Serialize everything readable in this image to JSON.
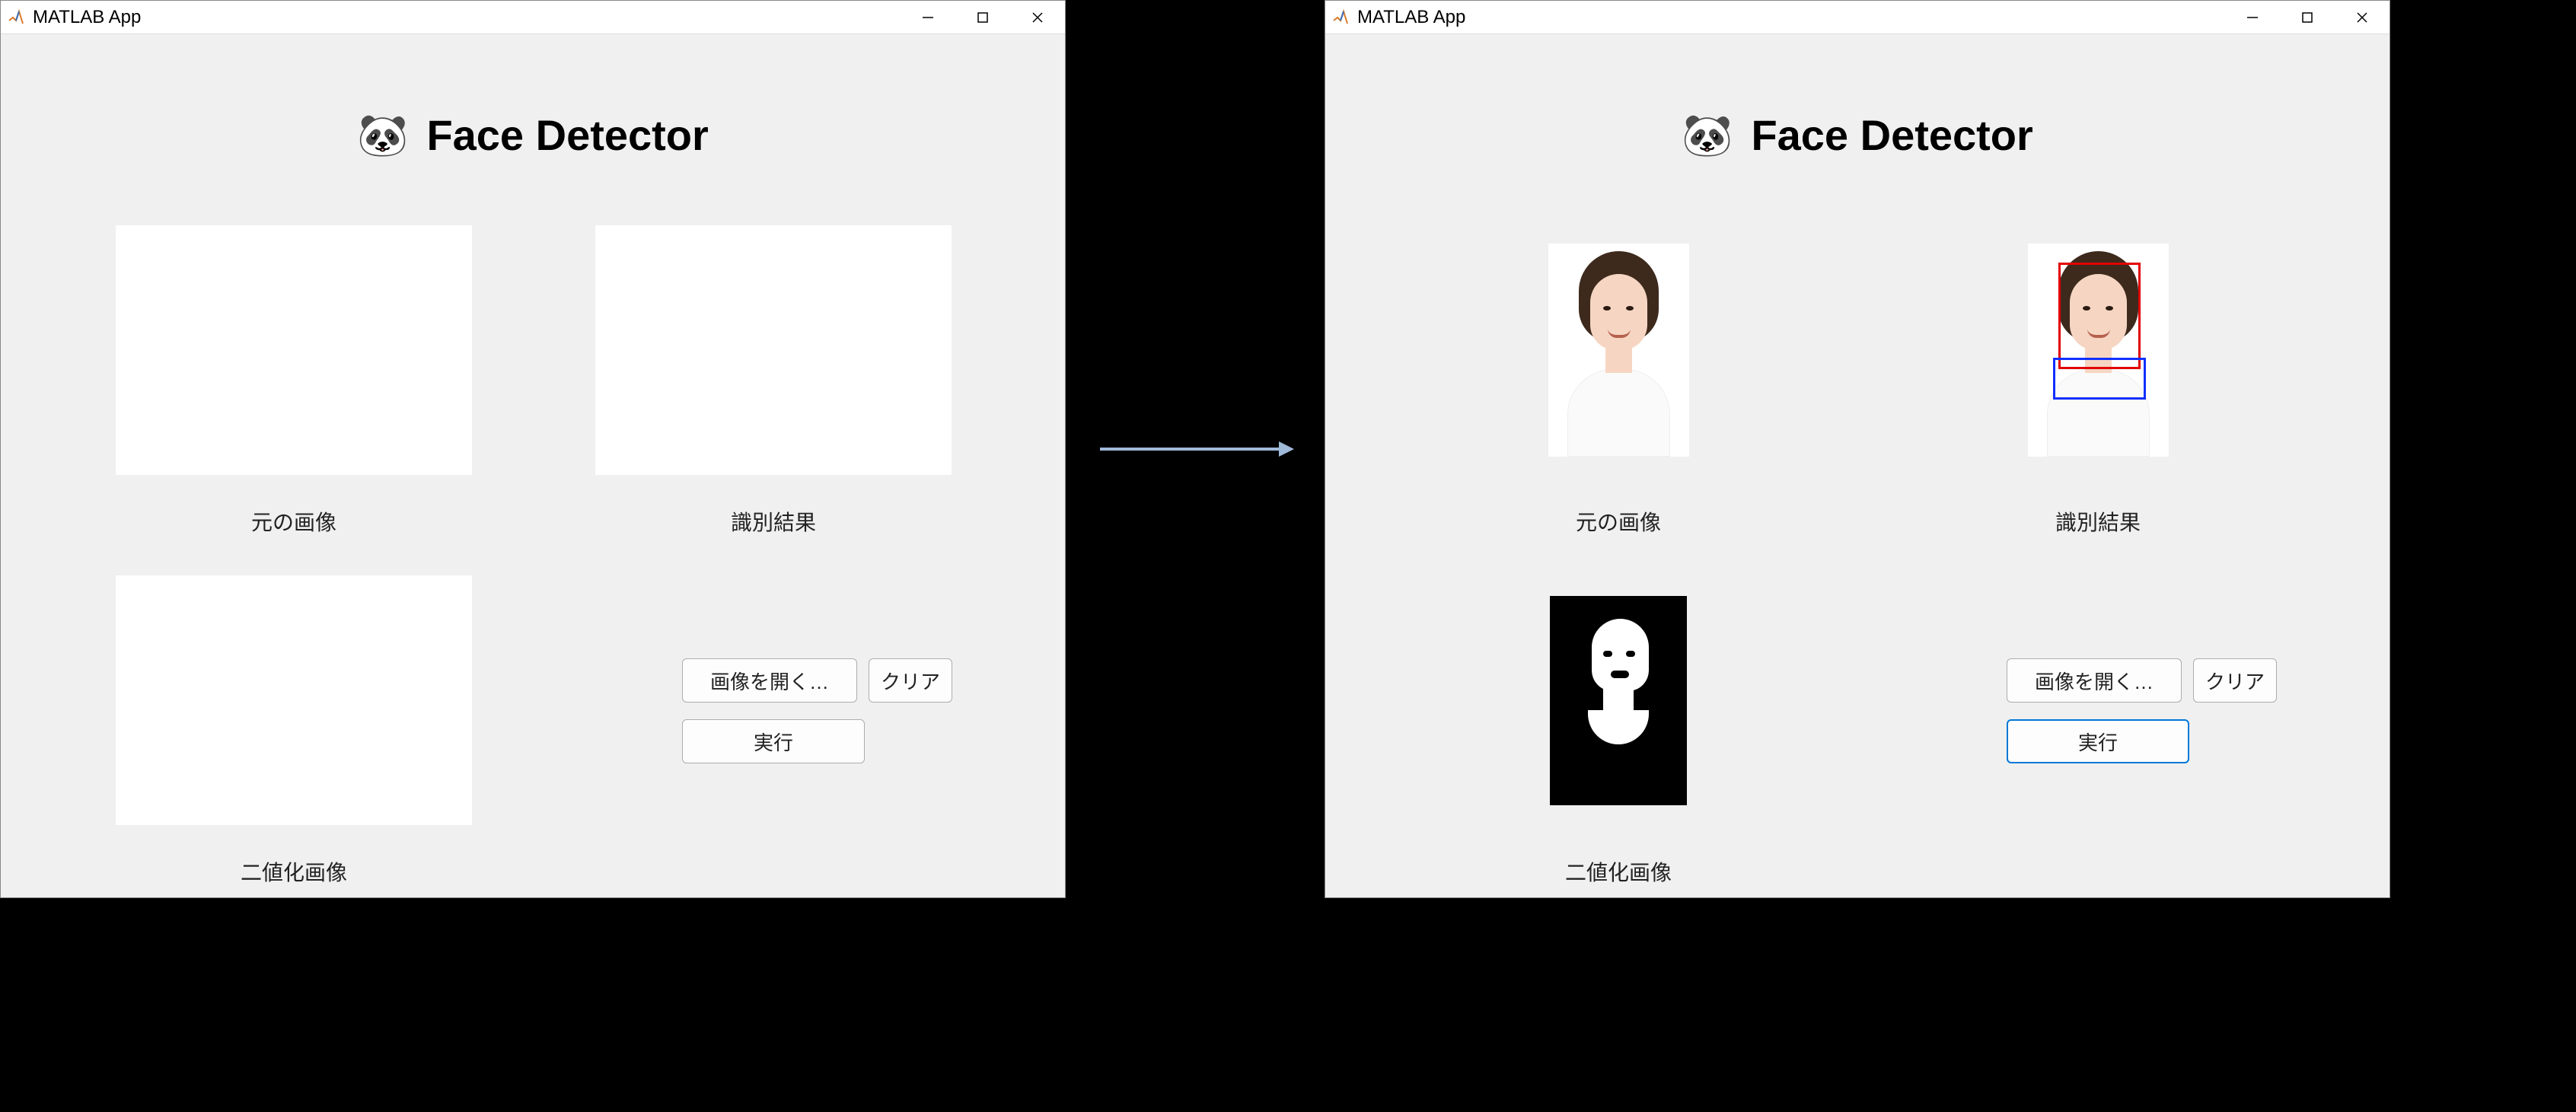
{
  "window": {
    "title": "MATLAB App",
    "controls": {
      "minimize": "–",
      "maximize": "□",
      "close": "✕"
    }
  },
  "heading": {
    "icon_name": "panda-icon",
    "icon_glyph": "🐼",
    "text": "Face Detector"
  },
  "labels": {
    "original": "元の画像",
    "result": "識別結果",
    "binary": "二値化画像"
  },
  "buttons": {
    "open": "画像を開く…",
    "clear": "クリア",
    "run": "実行"
  },
  "left_state": {
    "original_loaded": false,
    "result_loaded": false,
    "binary_loaded": false,
    "run_active": false
  },
  "right_state": {
    "original_loaded": true,
    "result_loaded": true,
    "binary_loaded": true,
    "run_active": true,
    "detections": [
      {
        "name": "face",
        "color": "#e20000"
      },
      {
        "name": "upper-body",
        "color": "#1030ff"
      }
    ]
  }
}
